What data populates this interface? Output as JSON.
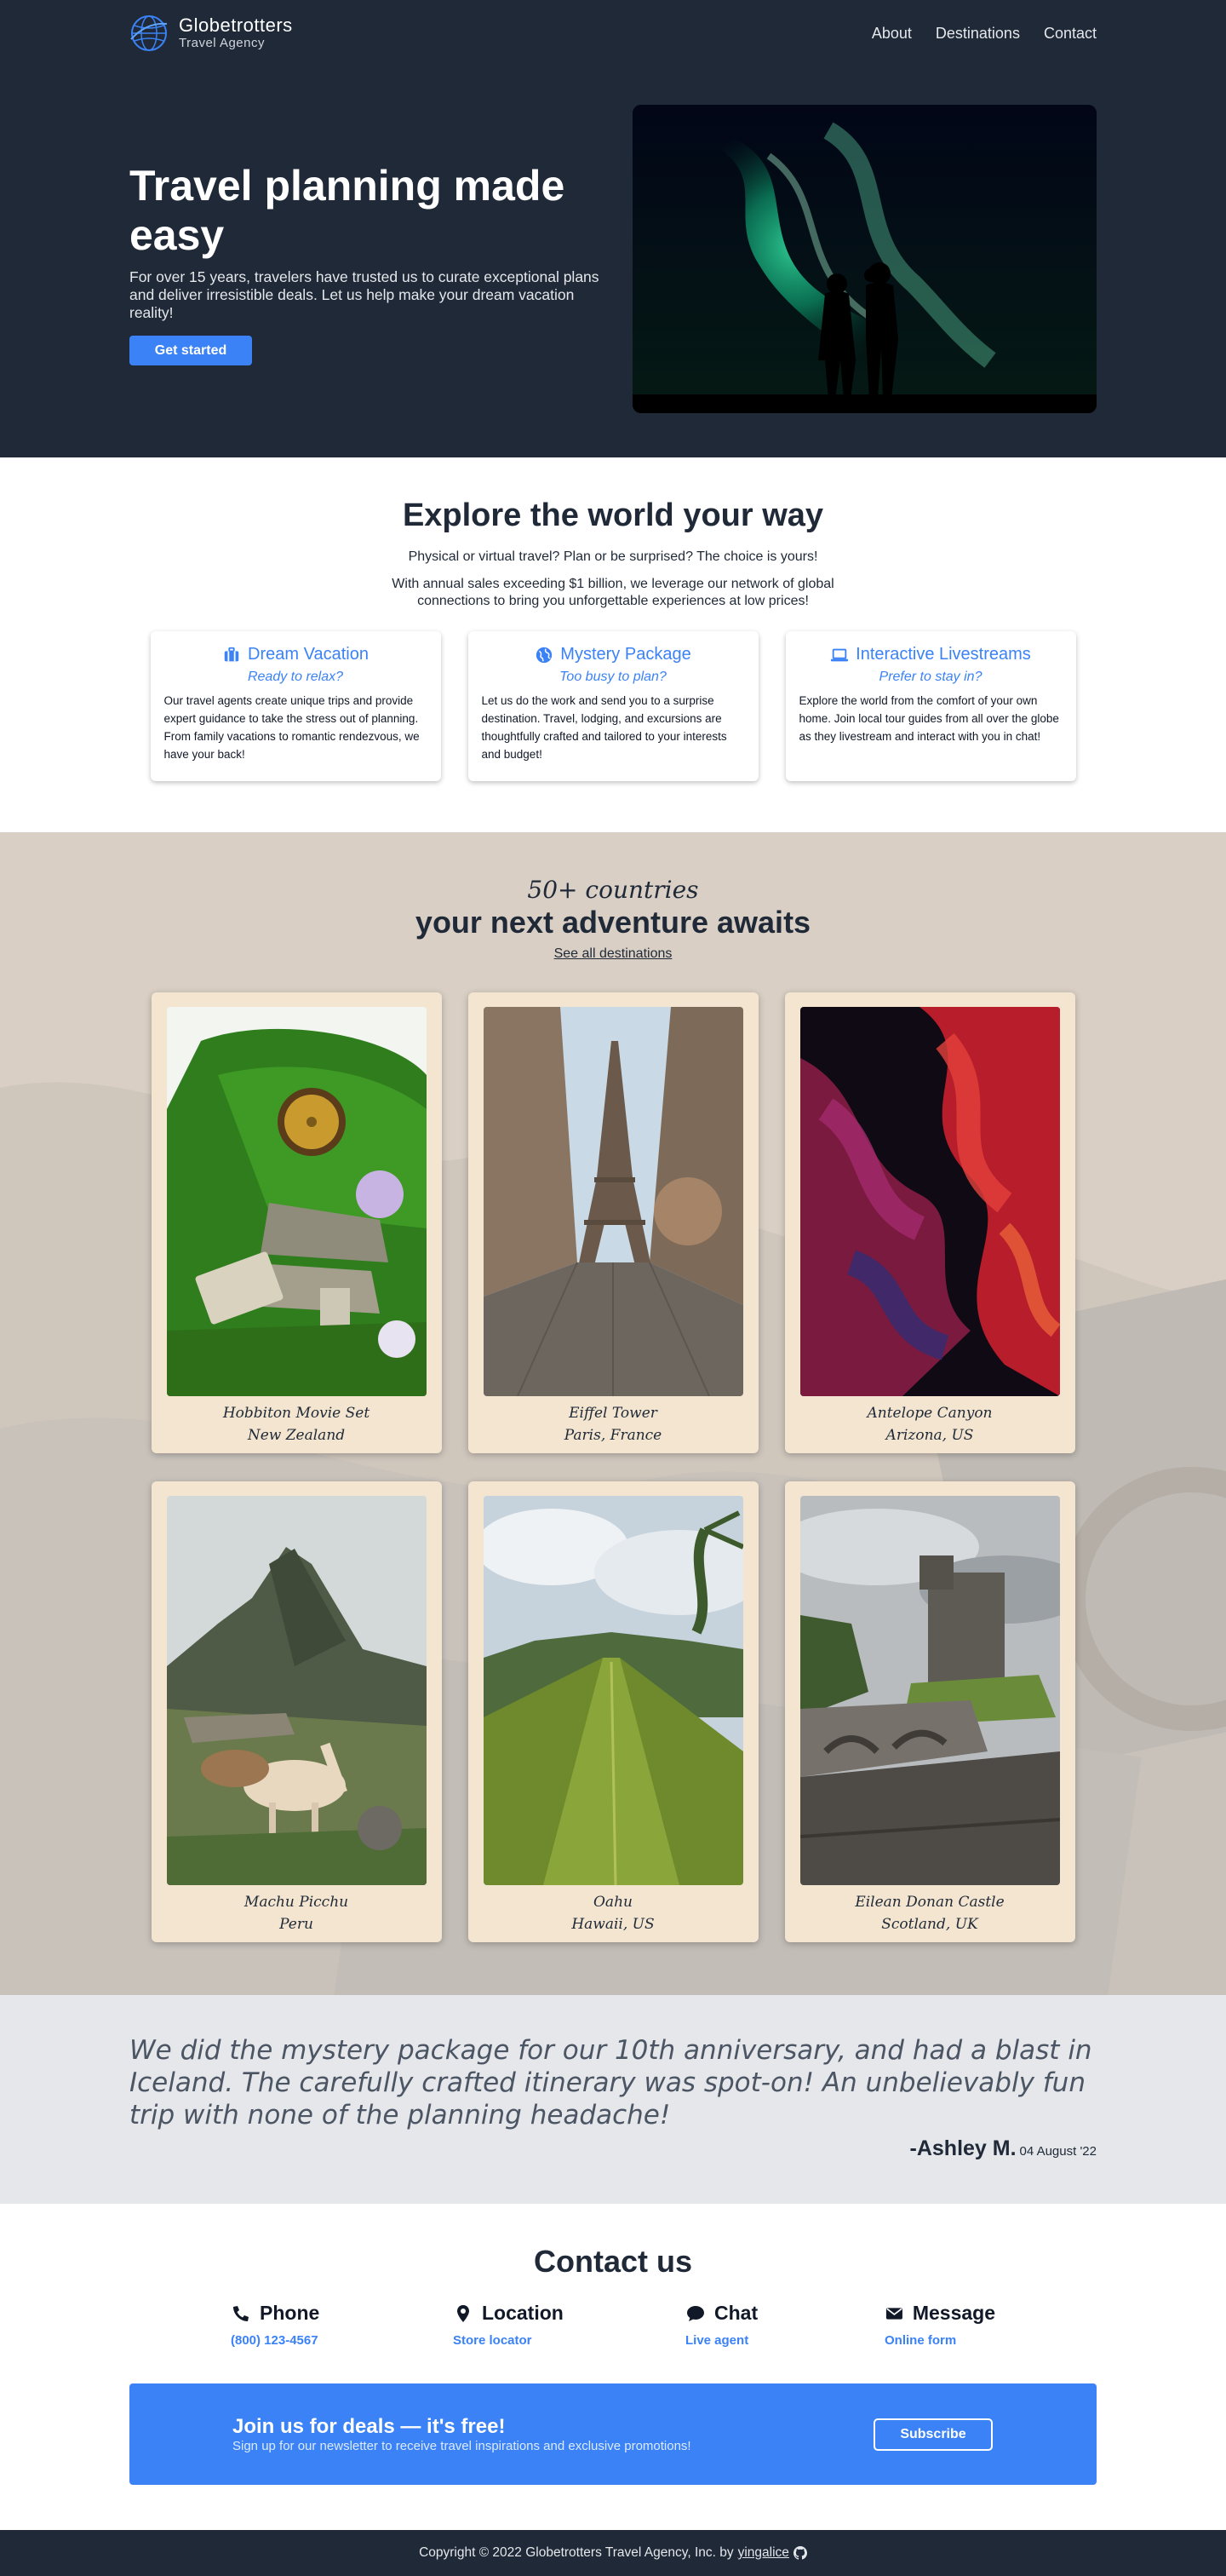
{
  "brand": {
    "name": "Globetrotters",
    "subtitle": "Travel Agency"
  },
  "nav": {
    "items": [
      {
        "label": "About"
      },
      {
        "label": "Destinations"
      },
      {
        "label": "Contact"
      }
    ]
  },
  "hero": {
    "title": "Travel planning made easy",
    "description": "For over 15 years, travelers have trusted us to curate exceptional plans and deliver irresistible deals. Let us help make your dream vacation reality!",
    "cta": "Get started"
  },
  "explore": {
    "title": "Explore the world your way",
    "intro": "Physical or virtual travel? Plan or be surprised? The choice is yours!",
    "body": "With annual sales exceeding $1 billion, we leverage our network of global connections to bring you unforgettable experiences at low prices!",
    "services": [
      {
        "icon": "suitcase-icon",
        "title": "Dream Vacation",
        "tagline": "Ready to relax?",
        "description": "Our travel agents create unique trips and provide expert guidance to take the stress out of planning. From family vacations to romantic rendezvous, we have your back!"
      },
      {
        "icon": "globe-icon",
        "title": "Mystery Package",
        "tagline": "Too busy to plan?",
        "description": "Let us do the work and send you to a surprise destination. Travel, lodging, and excursions are thoughtfully crafted and tailored to your interests and budget!"
      },
      {
        "icon": "laptop-icon",
        "title": "Interactive Livestreams",
        "tagline": "Prefer to stay in?",
        "description": "Explore the world from the comfort of your own home. Join local tour guides from all over the globe as they livestream and interact with you in chat!"
      }
    ]
  },
  "destinations": {
    "kicker": "50+ countries",
    "title": "your next adventure awaits",
    "link": "See all destinations",
    "cards": [
      {
        "name": "Hobbiton Movie Set",
        "location": "New Zealand"
      },
      {
        "name": "Eiffel Tower",
        "location": "Paris, France"
      },
      {
        "name": "Antelope Canyon",
        "location": "Arizona, US"
      },
      {
        "name": "Machu Picchu",
        "location": "Peru"
      },
      {
        "name": "Oahu",
        "location": "Hawaii, US"
      },
      {
        "name": "Eilean Donan Castle",
        "location": "Scotland, UK"
      }
    ]
  },
  "testimonial": {
    "quote": "We did the mystery package for our 10th anniversary, and had a blast in Iceland. The carefully crafted itinerary was spot-on! An unbelievably fun trip with none of the planning headache!",
    "author": "-Ashley M.",
    "date": "04 August '22"
  },
  "contact": {
    "title": "Contact us",
    "items": [
      {
        "icon": "phone-icon",
        "label": "Phone",
        "link": "(800) 123-4567"
      },
      {
        "icon": "map-pin-icon",
        "label": "Location",
        "link": "Store locator"
      },
      {
        "icon": "chat-bubble-icon",
        "label": "Chat",
        "link": "Live agent"
      },
      {
        "icon": "envelope-icon",
        "label": "Message",
        "link": "Online form"
      }
    ]
  },
  "newsletter": {
    "title": "Join us for deals — it's free!",
    "subtitle": "Sign up for our newsletter to receive travel inspirations and exclusive promotions!",
    "button": "Subscribe"
  },
  "footer": {
    "copyright": "Copyright © 2022 Globetrotters Travel Agency, Inc. by",
    "author": "yingalice"
  },
  "colors": {
    "dark": "#1f2937",
    "accent": "#3b82f6",
    "card": "#f3e5cf",
    "testimonial_bg": "#e5e7eb"
  }
}
